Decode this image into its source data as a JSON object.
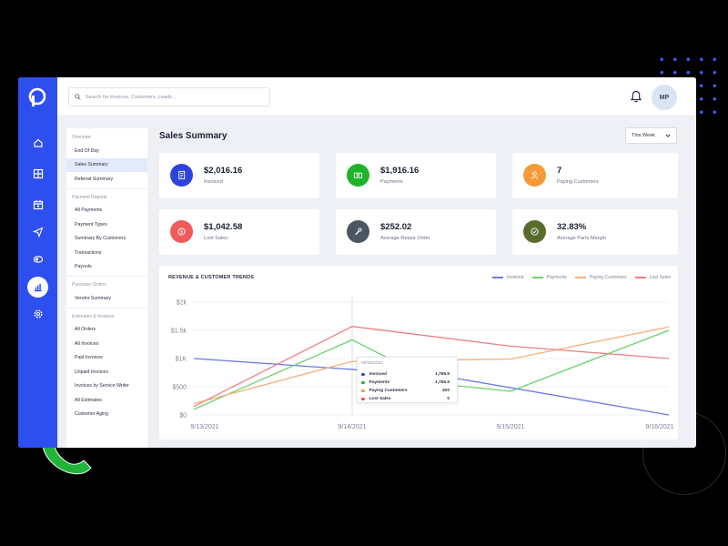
{
  "header": {
    "search_placeholder": "Search for Invoices, Customers, Leads...",
    "avatar_initials": "MP"
  },
  "rail": {
    "icons": [
      "home-icon",
      "grid-icon",
      "calendar-icon",
      "send-icon",
      "toggle-icon",
      "reports-icon",
      "settings-icon"
    ],
    "active": "reports-icon",
    "color": "#2e4ff0"
  },
  "subnav": {
    "sections": [
      {
        "title": "Overview",
        "items": [
          "End Of Day",
          "Sales Summary",
          "Referral Summary"
        ]
      },
      {
        "title": "Payment Reports",
        "items": [
          "All Payments",
          "Payment Types",
          "Summary By Customers",
          "Transactions",
          "Payouts"
        ]
      },
      {
        "title": "Purchase Orders",
        "items": [
          "Vendor Summary"
        ]
      },
      {
        "title": "Estimates & Invoices",
        "items": [
          "All Orders",
          "All Invoices",
          "Paid Invoices",
          "Unpaid Invoices",
          "Invoices by Service Writer",
          "All Estimates",
          "Customer Aging"
        ]
      }
    ],
    "active_item": "Sales Summary"
  },
  "main": {
    "title": "Sales Summary",
    "period_select": "This Week",
    "cards": [
      {
        "value": "$2,016.16",
        "label": "Invoiced",
        "icon": "invoice-icon",
        "color": "#2e43d9"
      },
      {
        "value": "$1,916.16",
        "label": "Payments",
        "icon": "money-icon",
        "color": "#1fb32a"
      },
      {
        "value": "7",
        "label": "Paying Customers",
        "icon": "user-icon",
        "color": "#f59a36"
      },
      {
        "value": "$1,042.58",
        "label": "Lost Sales",
        "icon": "dollar-icon",
        "color": "#ef5b5b"
      },
      {
        "value": "$252.02",
        "label": "Average Repair Order",
        "icon": "wrench-icon",
        "color": "#4b5563"
      },
      {
        "value": "32.83%",
        "label": "Average Parts Margin",
        "icon": "check-icon",
        "color": "#5a6b2e"
      }
    ]
  },
  "chart_data": {
    "type": "line",
    "title": "REVENUE & CUSTOMER TRENDS",
    "categories": [
      "9/13/2021",
      "9/14/2021",
      "9/15/2021",
      "9/16/2021"
    ],
    "x": [
      0,
      1,
      2,
      3
    ],
    "ytick_labels": [
      "$0",
      "$500",
      "$1K",
      "$1.5k",
      "$2k"
    ],
    "yticks": [
      0,
      500,
      1000,
      1500,
      2000
    ],
    "ylim": [
      0,
      2000
    ],
    "legend_position": "top-right",
    "grid": true,
    "series": [
      {
        "name": "Invoiced",
        "color": "#6b7be0",
        "points": [
          [
            0,
            1000
          ],
          [
            1.55,
            700
          ],
          [
            3,
            0
          ]
        ]
      },
      {
        "name": "Payments",
        "color": "#6bd36b",
        "points": [
          [
            0,
            100
          ],
          [
            1,
            1330
          ],
          [
            1.55,
            550
          ],
          [
            2,
            420
          ],
          [
            3,
            1500
          ]
        ]
      },
      {
        "name": "Paying Customers",
        "color": "#f6b27a",
        "points": [
          [
            0,
            200
          ],
          [
            1,
            950
          ],
          [
            2,
            990
          ],
          [
            3,
            1560
          ]
        ]
      },
      {
        "name": "Lost Sales",
        "color": "#ef8080",
        "points": [
          [
            0,
            150
          ],
          [
            1,
            1570
          ],
          [
            2,
            1220
          ],
          [
            3,
            1000
          ]
        ]
      }
    ],
    "hover_x": 1,
    "tooltip": {
      "date": "09/05/2021",
      "rows": [
        {
          "name": "Invoiced",
          "value": "1,766.5",
          "color": "#2e43d9"
        },
        {
          "name": "Payments",
          "value": "1,766.5",
          "color": "#1fb32a"
        },
        {
          "name": "Paying Customers",
          "value": "400",
          "color": "#f59a36"
        },
        {
          "name": "Lost Sales",
          "value": "0",
          "color": "#ef4444"
        }
      ]
    }
  }
}
